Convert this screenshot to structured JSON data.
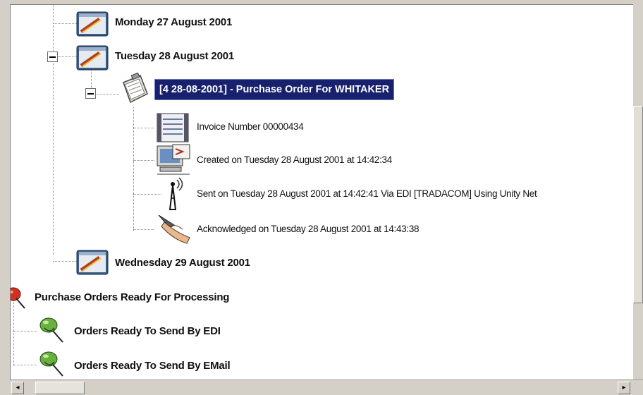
{
  "tree": {
    "nodes": {
      "monday": "Monday 27 August 2001",
      "tuesday": "Tuesday 28 August 2001",
      "purchase_order": "[4 28-08-2001] - Purchase Order For WHITAKER",
      "invoice": "Invoice Number 00000434",
      "created": "Created on Tuesday 28 August 2001 at 14:42:34",
      "sent": "Sent on Tuesday 28 August 2001 at 14:42:41  Via EDI [TRADACOM] Using Unity Net",
      "acknowledged": "Acknowledged on Tuesday 28 August 2001 at 14:43:38",
      "wednesday": "Wednesday 29 August 2001",
      "ready_processing": "Purchase Orders Ready For Processing",
      "ready_edi": "Orders Ready To Send By EDI",
      "ready_email": "Orders Ready To Send By EMail"
    }
  },
  "icons": {
    "calendar": "calendar-icon",
    "clipboard": "purchase-order-icon",
    "invoice": "invoice-icon",
    "computer": "computer-icon",
    "antenna": "antenna-icon",
    "handshake": "handshake-icon",
    "pushpin_red": "red-pushpin-icon",
    "pushpin_green": "green-pushpin-icon"
  },
  "colors": {
    "selection_bg": "#17216e",
    "selection_text": "#ffffff"
  }
}
